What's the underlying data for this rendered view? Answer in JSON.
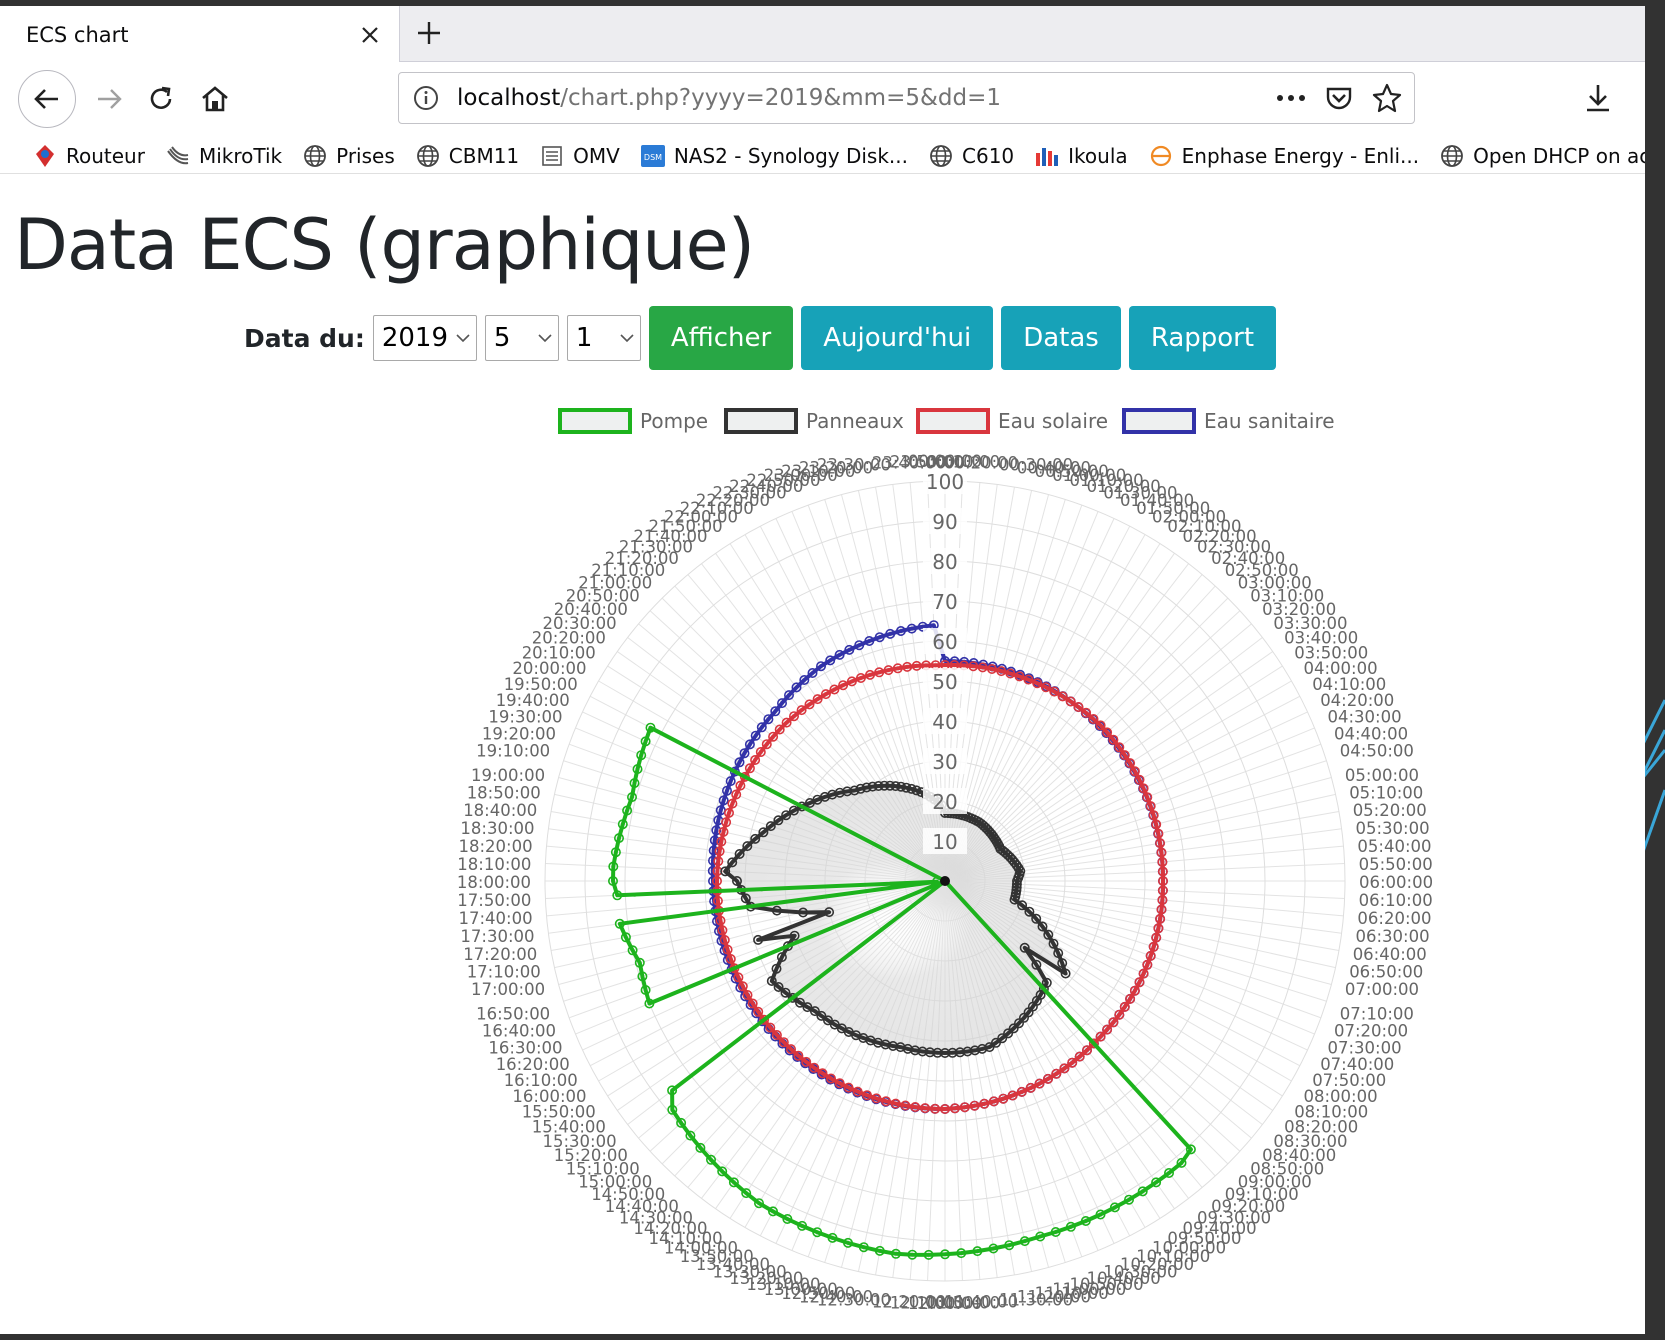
{
  "browser": {
    "tab_title": "ECS chart",
    "url_host": "localhost",
    "url_path": "/chart.php?yyyy=2019&mm=5&dd=1",
    "bookmarks": [
      {
        "label": "Routeur",
        "icon": "router-icon"
      },
      {
        "label": "MikroTik",
        "icon": "mikrotik-icon"
      },
      {
        "label": "Prises",
        "icon": "globe-icon"
      },
      {
        "label": "CBM11",
        "icon": "globe-icon"
      },
      {
        "label": "OMV",
        "icon": "list-icon"
      },
      {
        "label": "NAS2 - Synology Disk...",
        "icon": "dsm-icon"
      },
      {
        "label": "C610",
        "icon": "globe-icon"
      },
      {
        "label": "Ikoula",
        "icon": "ikoula-icon"
      },
      {
        "label": "Enphase Energy - Enli...",
        "icon": "enphase-icon"
      },
      {
        "label": "Open DHCP on acer-ym",
        "icon": "globe-icon"
      }
    ]
  },
  "page": {
    "title": "Data ECS (graphique)",
    "date_label": "Data du:",
    "year_value": "2019",
    "month_value": "5",
    "day_value": "1",
    "buttons": {
      "show": "Afficher",
      "today": "Aujourd'hui",
      "data": "Datas",
      "report": "Rapport"
    },
    "colors": {
      "green_button": "#28a745",
      "teal_button": "#17a2b8"
    }
  },
  "chart_data": {
    "type": "radar",
    "legend_position": "top",
    "r_range": [
      0,
      100
    ],
    "r_ticks": [
      10,
      20,
      30,
      40,
      50,
      60,
      70,
      80,
      90,
      100
    ],
    "labels": "every 10 minutes from 00:00:00 to 23:50:00 (144 labels)",
    "series": [
      {
        "name": "Pompe",
        "color": "#1db31d",
        "keyframes": [
          [
            "00:00:00",
            0
          ],
          [
            "09:00:00",
            0
          ],
          [
            "09:10:00",
            91
          ],
          [
            "09:20:00",
            92
          ],
          [
            "09:30:00",
            92
          ],
          [
            "11:00:00",
            92
          ],
          [
            "12:30:00",
            94
          ],
          [
            "14:00:00",
            93
          ],
          [
            "15:20:00",
            89
          ],
          [
            "15:30:00",
            86
          ],
          [
            "15:40:00",
            0
          ],
          [
            "16:20:00",
            0
          ],
          [
            "16:30:00",
            80
          ],
          [
            "17:00:00",
            79
          ],
          [
            "17:30:00",
            82
          ],
          [
            "17:40:00",
            2
          ],
          [
            "17:50:00",
            82
          ],
          [
            "18:00:00",
            83
          ],
          [
            "18:10:00",
            83
          ],
          [
            "19:00:00",
            81
          ],
          [
            "19:50:00",
            83
          ],
          [
            "20:00:00",
            0
          ],
          [
            "23:50:00",
            0
          ]
        ]
      },
      {
        "name": "Panneaux",
        "color": "#333333",
        "keyframes": [
          [
            "00:00:00",
            17
          ],
          [
            "02:00:00",
            17
          ],
          [
            "04:00:00",
            16
          ],
          [
            "05:30:00",
            19
          ],
          [
            "06:00:00",
            18
          ],
          [
            "07:00:00",
            18
          ],
          [
            "08:30:00",
            38
          ],
          [
            "08:40:00",
            26
          ],
          [
            "09:00:00",
            36
          ],
          [
            "11:00:00",
            43
          ],
          [
            "13:00:00",
            43
          ],
          [
            "15:00:00",
            46
          ],
          [
            "16:00:00",
            50
          ],
          [
            "16:40:00",
            40
          ],
          [
            "16:50:00",
            49
          ],
          [
            "17:00:00",
            30
          ],
          [
            "17:30:00",
            49
          ],
          [
            "18:00:00",
            52
          ],
          [
            "18:10:00",
            55
          ],
          [
            "19:00:00",
            47
          ],
          [
            "20:00:00",
            39
          ],
          [
            "21:00:00",
            32
          ],
          [
            "23:00:00",
            23
          ],
          [
            "23:50:00",
            19
          ]
        ]
      },
      {
        "name": "Eau solaire",
        "color": "#d9363e",
        "keyframes": [
          [
            "00:00:00",
            54
          ],
          [
            "03:00:00",
            55
          ],
          [
            "06:00:00",
            54.5
          ],
          [
            "09:00:00",
            55
          ],
          [
            "12:00:00",
            57
          ],
          [
            "15:00:00",
            57
          ],
          [
            "18:00:00",
            57
          ],
          [
            "21:00:00",
            56
          ],
          [
            "23:50:00",
            54
          ]
        ]
      },
      {
        "name": "Eau sanitaire",
        "color": "#3232a8",
        "keyframes": [
          [
            "00:00:00",
            55
          ],
          [
            "06:00:00",
            54.5
          ],
          [
            "09:00:00",
            55
          ],
          [
            "12:00:00",
            57
          ],
          [
            "18:00:00",
            58
          ],
          [
            "21:00:00",
            60
          ],
          [
            "22:00:00",
            62
          ],
          [
            "23:50:00",
            64
          ]
        ]
      }
    ]
  }
}
